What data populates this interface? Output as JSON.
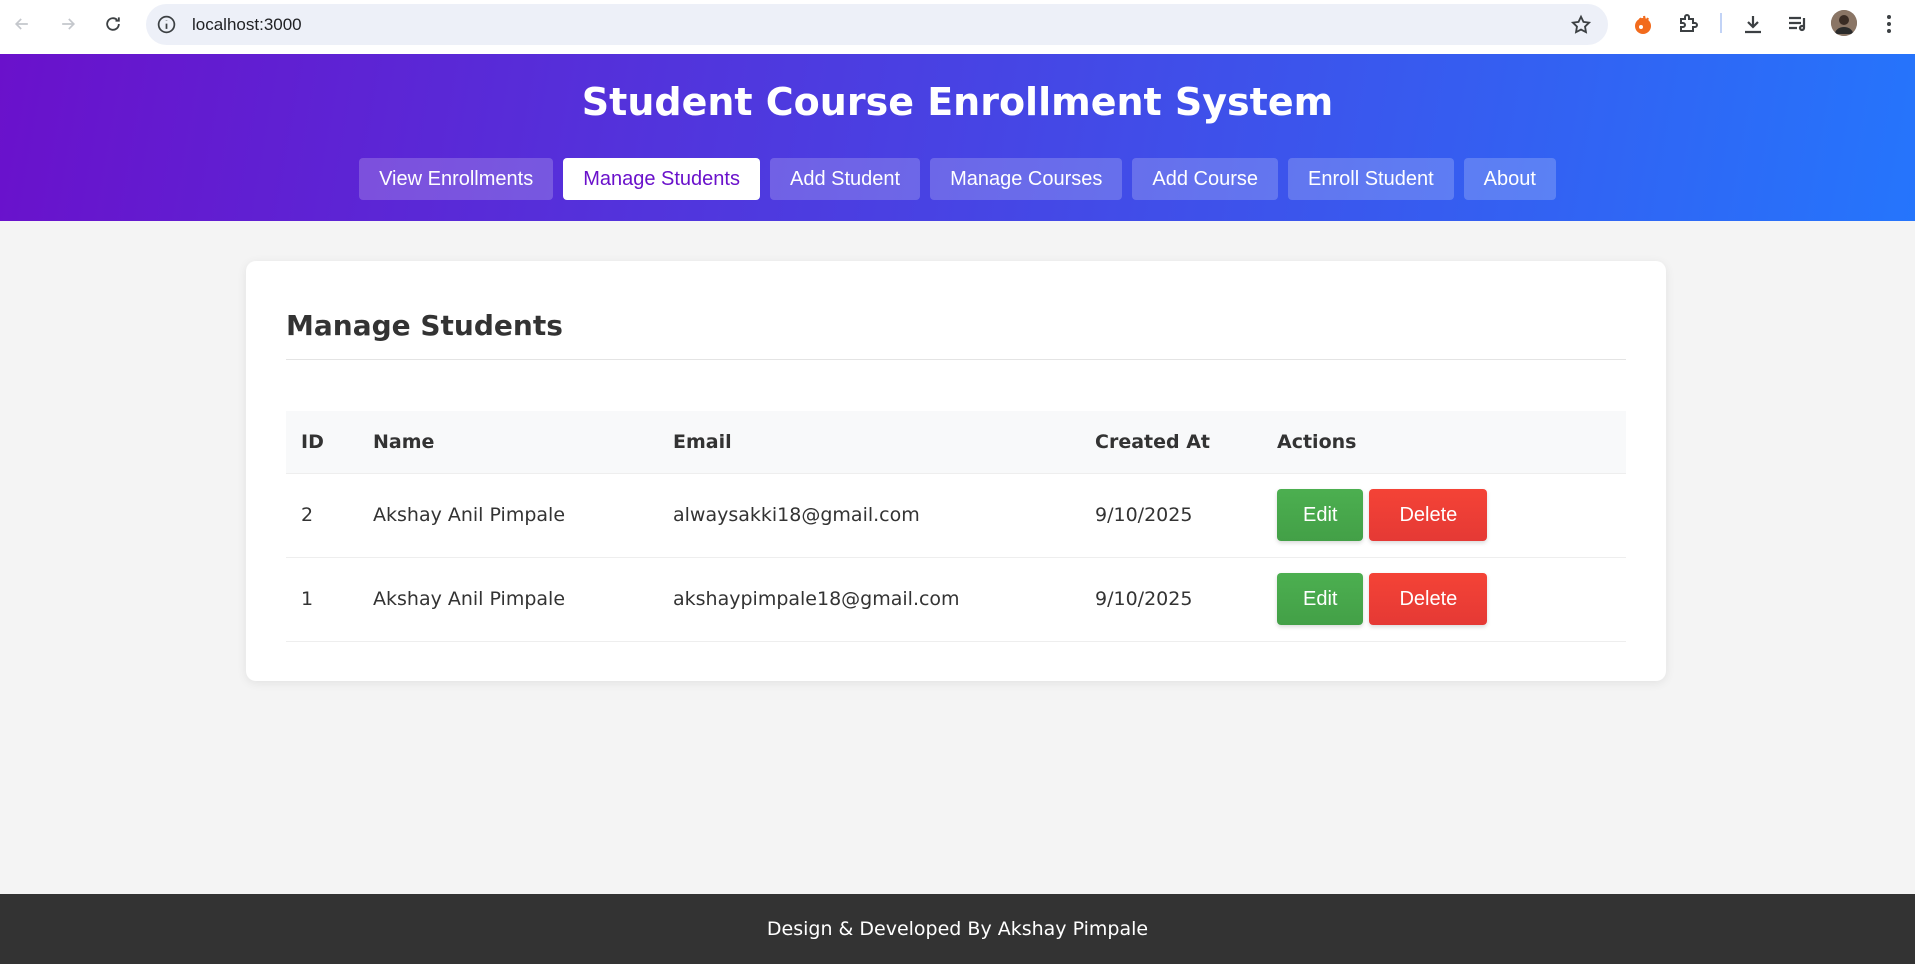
{
  "browser": {
    "url": "localhost:3000",
    "icons": [
      "back-icon",
      "forward-icon",
      "reload-icon",
      "site-info-icon",
      "bookmark-star-icon",
      "extension-orange-icon",
      "extensions-puzzle-icon",
      "download-icon",
      "reading-list-icon",
      "profile-avatar",
      "more-menu-icon"
    ]
  },
  "header": {
    "title": "Student Course Enrollment System",
    "nav": [
      {
        "label": "View Enrollments",
        "active": false
      },
      {
        "label": "Manage Students",
        "active": true
      },
      {
        "label": "Add Student",
        "active": false
      },
      {
        "label": "Manage Courses",
        "active": false
      },
      {
        "label": "Add Course",
        "active": false
      },
      {
        "label": "Enroll Student",
        "active": false
      },
      {
        "label": "About",
        "active": false
      }
    ],
    "gradient": [
      "#6a11cb",
      "#2575fc"
    ]
  },
  "main": {
    "title": "Manage Students",
    "table": {
      "headers": [
        "ID",
        "Name",
        "Email",
        "Created At",
        "Actions"
      ],
      "rows": [
        {
          "id": "2",
          "name": "Akshay Anil Pimpale",
          "email": "alwaysakki18@gmail.com",
          "created_at": "9/10/2025"
        },
        {
          "id": "1",
          "name": "Akshay Anil Pimpale",
          "email": "akshaypimpale18@gmail.com",
          "created_at": "9/10/2025"
        }
      ],
      "actions": {
        "edit": "Edit",
        "delete": "Delete"
      }
    }
  },
  "colors": {
    "edit": "#43a047",
    "delete": "#e53935"
  },
  "footer": {
    "text": "Design & Developed By Akshay Pimpale"
  }
}
